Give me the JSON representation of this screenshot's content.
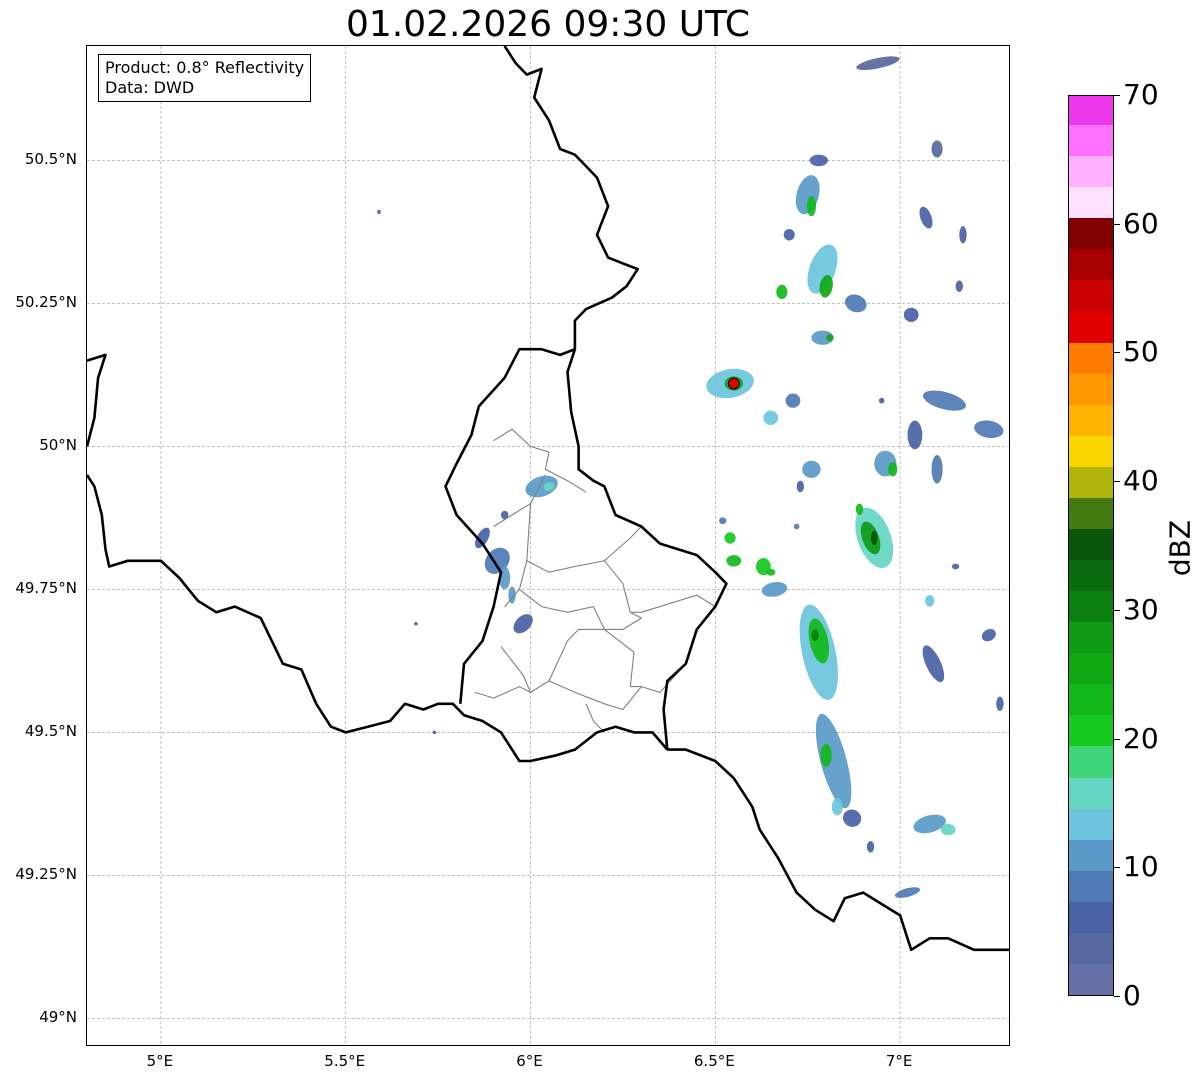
{
  "title": "01.02.2026 09:30 UTC",
  "info": {
    "product": "Product: 0.8° Reflectivity",
    "data": "Data: DWD"
  },
  "map_extent": {
    "lon": [
      4.8,
      7.3
    ],
    "lat": [
      48.95,
      50.7
    ]
  },
  "lat_ticks": [
    {
      "value": 50.5,
      "label": "50.5°N"
    },
    {
      "value": 50.25,
      "label": "50.25°N"
    },
    {
      "value": 50.0,
      "label": "50°N"
    },
    {
      "value": 49.75,
      "label": "49.75°N"
    },
    {
      "value": 49.5,
      "label": "49.5°N"
    },
    {
      "value": 49.25,
      "label": "49.25°N"
    },
    {
      "value": 49.0,
      "label": "49°N"
    }
  ],
  "lon_ticks": [
    {
      "value": 5.0,
      "label": "5°E"
    },
    {
      "value": 5.5,
      "label": "5.5°E"
    },
    {
      "value": 6.0,
      "label": "6°E"
    },
    {
      "value": 6.5,
      "label": "6.5°E"
    },
    {
      "value": 7.0,
      "label": "7°E"
    }
  ],
  "radar_site": {
    "lon": 6.55,
    "lat": 50.11,
    "color": "#e00000"
  },
  "borders": {
    "country": [
      [
        [
          5.93,
          50.7
        ],
        [
          5.96,
          50.67
        ],
        [
          5.99,
          50.65
        ],
        [
          6.03,
          50.66
        ],
        [
          6.01,
          50.61
        ],
        [
          6.05,
          50.57
        ],
        [
          6.08,
          50.52
        ],
        [
          6.12,
          50.51
        ],
        [
          6.15,
          50.49
        ],
        [
          6.18,
          50.47
        ],
        [
          6.21,
          50.42
        ],
        [
          6.18,
          50.37
        ],
        [
          6.21,
          50.33
        ],
        [
          6.25,
          50.32
        ],
        [
          6.29,
          50.31
        ],
        [
          6.26,
          50.28
        ],
        [
          6.22,
          50.26
        ],
        [
          6.15,
          50.24
        ],
        [
          6.12,
          50.22
        ],
        [
          6.12,
          50.17
        ],
        [
          6.1,
          50.13
        ],
        [
          6.11,
          50.06
        ],
        [
          6.13,
          50.0
        ],
        [
          6.13,
          49.96
        ],
        [
          6.17,
          49.94
        ],
        [
          6.2,
          49.93
        ],
        [
          6.23,
          49.88
        ],
        [
          6.3,
          49.86
        ],
        [
          6.35,
          49.83
        ],
        [
          6.4,
          49.82
        ],
        [
          6.45,
          49.81
        ],
        [
          6.5,
          49.78
        ],
        [
          6.53,
          49.76
        ],
        [
          6.5,
          49.72
        ],
        [
          6.45,
          49.68
        ],
        [
          6.42,
          49.62
        ],
        [
          6.37,
          49.59
        ],
        [
          6.36,
          49.54
        ],
        [
          6.37,
          49.47
        ]
      ],
      [
        [
          6.37,
          49.47
        ],
        [
          6.33,
          49.5
        ],
        [
          6.28,
          49.5
        ],
        [
          6.23,
          49.51
        ],
        [
          6.18,
          49.5
        ],
        [
          6.12,
          49.47
        ],
        [
          6.07,
          49.46
        ],
        [
          6.0,
          49.45
        ],
        [
          5.97,
          49.45
        ],
        [
          5.92,
          49.5
        ],
        [
          5.87,
          49.52
        ],
        [
          5.82,
          49.53
        ],
        [
          5.79,
          49.55
        ],
        [
          5.75,
          49.55
        ],
        [
          5.71,
          49.54
        ],
        [
          5.66,
          49.55
        ],
        [
          5.62,
          49.52
        ],
        [
          5.56,
          49.51
        ],
        [
          5.5,
          49.5
        ],
        [
          5.46,
          49.51
        ],
        [
          5.42,
          49.55
        ],
        [
          5.38,
          49.61
        ],
        [
          5.33,
          49.62
        ],
        [
          5.3,
          49.66
        ],
        [
          5.27,
          49.7
        ],
        [
          5.2,
          49.72
        ],
        [
          5.15,
          49.71
        ],
        [
          5.1,
          49.73
        ],
        [
          5.05,
          49.77
        ],
        [
          5.0,
          49.8
        ],
        [
          4.95,
          49.8
        ],
        [
          4.91,
          49.8
        ],
        [
          4.86,
          49.79
        ],
        [
          4.85,
          49.82
        ],
        [
          4.84,
          49.88
        ],
        [
          4.82,
          49.93
        ],
        [
          4.8,
          49.95
        ]
      ],
      [
        [
          6.37,
          49.47
        ],
        [
          6.42,
          49.47
        ],
        [
          6.5,
          49.45
        ],
        [
          6.55,
          49.42
        ],
        [
          6.6,
          49.37
        ],
        [
          6.62,
          49.33
        ],
        [
          6.67,
          49.28
        ],
        [
          6.72,
          49.22
        ],
        [
          6.77,
          49.19
        ],
        [
          6.82,
          49.17
        ],
        [
          6.85,
          49.21
        ],
        [
          6.9,
          49.22
        ],
        [
          6.95,
          49.2
        ],
        [
          7.0,
          49.18
        ],
        [
          7.03,
          49.12
        ],
        [
          7.08,
          49.14
        ],
        [
          7.13,
          49.14
        ],
        [
          7.2,
          49.12
        ],
        [
          7.25,
          49.12
        ],
        [
          7.3,
          49.12
        ]
      ],
      [
        [
          4.8,
          50.15
        ],
        [
          4.85,
          50.16
        ],
        [
          4.83,
          50.12
        ],
        [
          4.82,
          50.05
        ],
        [
          4.8,
          50.0
        ]
      ],
      [
        [
          5.81,
          49.55
        ],
        [
          5.82,
          49.62
        ],
        [
          5.87,
          49.66
        ],
        [
          5.9,
          49.72
        ],
        [
          5.92,
          49.78
        ],
        [
          5.87,
          49.83
        ],
        [
          5.8,
          49.88
        ],
        [
          5.77,
          49.93
        ],
        [
          5.8,
          49.97
        ],
        [
          5.84,
          50.02
        ],
        [
          5.86,
          50.07
        ],
        [
          5.93,
          50.12
        ],
        [
          5.97,
          50.17
        ],
        [
          6.03,
          50.17
        ],
        [
          6.08,
          50.16
        ],
        [
          6.12,
          50.17
        ]
      ]
    ],
    "admin": [
      [
        [
          5.9,
          50.01
        ],
        [
          5.95,
          50.03
        ],
        [
          6.0,
          50.0
        ],
        [
          6.05,
          49.99
        ],
        [
          6.04,
          49.96
        ],
        [
          6.1,
          49.94
        ],
        [
          6.15,
          49.92
        ]
      ],
      [
        [
          5.9,
          49.86
        ],
        [
          5.95,
          49.88
        ],
        [
          6.0,
          49.9
        ],
        [
          6.04,
          49.95
        ]
      ],
      [
        [
          6.0,
          49.9
        ],
        [
          5.99,
          49.8
        ],
        [
          6.05,
          49.78
        ],
        [
          6.12,
          49.79
        ],
        [
          6.2,
          49.8
        ],
        [
          6.27,
          49.84
        ],
        [
          6.3,
          49.86
        ]
      ],
      [
        [
          5.93,
          49.72
        ],
        [
          5.97,
          49.75
        ],
        [
          5.99,
          49.8
        ]
      ],
      [
        [
          6.2,
          49.8
        ],
        [
          6.25,
          49.76
        ],
        [
          6.27,
          49.71
        ],
        [
          6.3,
          49.71
        ],
        [
          6.4,
          49.73
        ],
        [
          6.45,
          49.74
        ],
        [
          6.5,
          49.72
        ]
      ],
      [
        [
          5.97,
          49.75
        ],
        [
          6.03,
          49.72
        ],
        [
          6.1,
          49.71
        ],
        [
          6.17,
          49.72
        ],
        [
          6.2,
          49.68
        ]
      ],
      [
        [
          6.2,
          49.68
        ],
        [
          6.25,
          49.68
        ],
        [
          6.3,
          49.7
        ],
        [
          6.27,
          49.71
        ]
      ],
      [
        [
          5.92,
          49.65
        ],
        [
          5.98,
          49.6
        ],
        [
          6.0,
          49.57
        ],
        [
          6.05,
          49.59
        ],
        [
          6.12,
          49.57
        ],
        [
          6.2,
          49.55
        ],
        [
          6.25,
          49.54
        ],
        [
          6.3,
          49.58
        ],
        [
          6.35,
          49.57
        ],
        [
          6.42,
          49.62
        ]
      ],
      [
        [
          6.2,
          49.68
        ],
        [
          6.28,
          49.64
        ],
        [
          6.27,
          49.58
        ],
        [
          6.3,
          49.58
        ]
      ],
      [
        [
          6.05,
          49.59
        ],
        [
          6.1,
          49.66
        ],
        [
          6.13,
          49.68
        ],
        [
          6.2,
          49.68
        ]
      ],
      [
        [
          5.85,
          49.57
        ],
        [
          5.9,
          49.56
        ],
        [
          5.97,
          49.58
        ],
        [
          6.0,
          49.57
        ]
      ],
      [
        [
          6.15,
          49.55
        ],
        [
          6.17,
          49.52
        ],
        [
          6.2,
          49.5
        ]
      ]
    ]
  },
  "echoes": [
    {
      "lon": 6.94,
      "lat": 50.67,
      "w": 0.12,
      "h": 0.018,
      "rot": -12,
      "dbz": 3
    },
    {
      "lon": 6.78,
      "lat": 50.5,
      "w": 0.05,
      "h": 0.02,
      "rot": 0,
      "dbz": 5
    },
    {
      "lon": 6.75,
      "lat": 50.44,
      "w": 0.06,
      "h": 0.07,
      "rot": 15,
      "dbz": 12
    },
    {
      "lon": 6.76,
      "lat": 50.42,
      "w": 0.025,
      "h": 0.035,
      "rot": 0,
      "dbz": 22
    },
    {
      "lon": 6.7,
      "lat": 50.37,
      "w": 0.03,
      "h": 0.02,
      "rot": 0,
      "dbz": 6
    },
    {
      "lon": 6.79,
      "lat": 50.31,
      "w": 0.07,
      "h": 0.09,
      "rot": 20,
      "dbz": 14
    },
    {
      "lon": 6.8,
      "lat": 50.28,
      "w": 0.035,
      "h": 0.04,
      "rot": 10,
      "dbz": 26
    },
    {
      "lon": 6.68,
      "lat": 50.27,
      "w": 0.03,
      "h": 0.025,
      "rot": 0,
      "dbz": 22
    },
    {
      "lon": 6.88,
      "lat": 50.25,
      "w": 0.06,
      "h": 0.03,
      "rot": 20,
      "dbz": 8
    },
    {
      "lon": 6.79,
      "lat": 50.19,
      "w": 0.06,
      "h": 0.025,
      "rot": 0,
      "dbz": 12
    },
    {
      "lon": 6.81,
      "lat": 50.19,
      "w": 0.02,
      "h": 0.012,
      "rot": 0,
      "dbz": 26
    },
    {
      "lon": 7.03,
      "lat": 50.23,
      "w": 0.04,
      "h": 0.025,
      "rot": 0,
      "dbz": 6
    },
    {
      "lon": 7.07,
      "lat": 50.4,
      "w": 0.03,
      "h": 0.04,
      "rot": -20,
      "dbz": 6
    },
    {
      "lon": 7.17,
      "lat": 50.37,
      "w": 0.02,
      "h": 0.03,
      "rot": 0,
      "dbz": 6
    },
    {
      "lon": 7.16,
      "lat": 50.28,
      "w": 0.02,
      "h": 0.02,
      "rot": 0,
      "dbz": 6
    },
    {
      "lon": 7.1,
      "lat": 50.52,
      "w": 0.03,
      "h": 0.03,
      "rot": 0,
      "dbz": 3
    },
    {
      "lon": 5.59,
      "lat": 50.41,
      "w": 0.01,
      "h": 0.008,
      "rot": 0,
      "dbz": 5
    },
    {
      "lon": 6.54,
      "lat": 50.11,
      "w": 0.13,
      "h": 0.05,
      "rot": -10,
      "dbz": 14
    },
    {
      "lon": 6.55,
      "lat": 50.11,
      "w": 0.05,
      "h": 0.025,
      "rot": 0,
      "dbz": 25
    },
    {
      "lon": 6.65,
      "lat": 50.05,
      "w": 0.04,
      "h": 0.025,
      "rot": 0,
      "dbz": 14
    },
    {
      "lon": 6.71,
      "lat": 50.08,
      "w": 0.04,
      "h": 0.025,
      "rot": 0,
      "dbz": 8
    },
    {
      "lon": 7.12,
      "lat": 50.08,
      "w": 0.12,
      "h": 0.03,
      "rot": 15,
      "dbz": 8
    },
    {
      "lon": 7.24,
      "lat": 50.03,
      "w": 0.08,
      "h": 0.03,
      "rot": 10,
      "dbz": 8
    },
    {
      "lon": 7.04,
      "lat": 50.02,
      "w": 0.04,
      "h": 0.05,
      "rot": 0,
      "dbz": 6
    },
    {
      "lon": 6.96,
      "lat": 49.97,
      "w": 0.06,
      "h": 0.045,
      "rot": 0,
      "dbz": 10
    },
    {
      "lon": 6.98,
      "lat": 49.96,
      "w": 0.025,
      "h": 0.025,
      "rot": 0,
      "dbz": 22
    },
    {
      "lon": 7.1,
      "lat": 49.96,
      "w": 0.03,
      "h": 0.05,
      "rot": 0,
      "dbz": 8
    },
    {
      "lon": 6.76,
      "lat": 49.96,
      "w": 0.05,
      "h": 0.03,
      "rot": 0,
      "dbz": 12
    },
    {
      "lon": 6.73,
      "lat": 49.93,
      "w": 0.02,
      "h": 0.02,
      "rot": 0,
      "dbz": 6
    },
    {
      "lon": 6.93,
      "lat": 49.84,
      "w": 0.09,
      "h": 0.11,
      "rot": -20,
      "dbz": 16
    },
    {
      "lon": 6.92,
      "lat": 49.84,
      "w": 0.045,
      "h": 0.06,
      "rot": -20,
      "dbz": 28
    },
    {
      "lon": 6.93,
      "lat": 49.84,
      "w": 0.018,
      "h": 0.025,
      "rot": 0,
      "dbz": 34
    },
    {
      "lon": 6.89,
      "lat": 49.89,
      "w": 0.02,
      "h": 0.02,
      "rot": 0,
      "dbz": 22
    },
    {
      "lon": 7.08,
      "lat": 49.73,
      "w": 0.025,
      "h": 0.02,
      "rot": 0,
      "dbz": 14
    },
    {
      "lon": 7.15,
      "lat": 49.79,
      "w": 0.02,
      "h": 0.01,
      "rot": 0,
      "dbz": 6
    },
    {
      "lon": 6.03,
      "lat": 49.93,
      "w": 0.09,
      "h": 0.035,
      "rot": -18,
      "dbz": 10
    },
    {
      "lon": 6.05,
      "lat": 49.93,
      "w": 0.03,
      "h": 0.015,
      "rot": -18,
      "dbz": 16
    },
    {
      "lon": 5.91,
      "lat": 49.8,
      "w": 0.06,
      "h": 0.05,
      "rot": 40,
      "dbz": 8
    },
    {
      "lon": 5.93,
      "lat": 49.77,
      "w": 0.03,
      "h": 0.04,
      "rot": 0,
      "dbz": 12
    },
    {
      "lon": 5.87,
      "lat": 49.84,
      "w": 0.03,
      "h": 0.04,
      "rot": 30,
      "dbz": 7
    },
    {
      "lon": 5.95,
      "lat": 49.74,
      "w": 0.02,
      "h": 0.03,
      "rot": 0,
      "dbz": 10
    },
    {
      "lon": 5.93,
      "lat": 49.88,
      "w": 0.02,
      "h": 0.015,
      "rot": 0,
      "dbz": 6
    },
    {
      "lon": 5.98,
      "lat": 49.69,
      "w": 0.04,
      "h": 0.04,
      "rot": 45,
      "dbz": 6
    },
    {
      "lon": 6.54,
      "lat": 49.84,
      "w": 0.03,
      "h": 0.02,
      "rot": 0,
      "dbz": 20
    },
    {
      "lon": 6.55,
      "lat": 49.8,
      "w": 0.04,
      "h": 0.02,
      "rot": 0,
      "dbz": 22
    },
    {
      "lon": 6.63,
      "lat": 49.79,
      "w": 0.04,
      "h": 0.03,
      "rot": 0,
      "dbz": 20
    },
    {
      "lon": 6.66,
      "lat": 49.75,
      "w": 0.07,
      "h": 0.025,
      "rot": -10,
      "dbz": 12
    },
    {
      "lon": 6.65,
      "lat": 49.78,
      "w": 0.025,
      "h": 0.012,
      "rot": 0,
      "dbz": 24
    },
    {
      "lon": 6.52,
      "lat": 49.87,
      "w": 0.02,
      "h": 0.012,
      "rot": 0,
      "dbz": 8
    },
    {
      "lon": 6.72,
      "lat": 49.86,
      "w": 0.015,
      "h": 0.01,
      "rot": 0,
      "dbz": 8
    },
    {
      "lon": 6.78,
      "lat": 49.64,
      "w": 0.09,
      "h": 0.17,
      "rot": -12,
      "dbz": 14
    },
    {
      "lon": 6.78,
      "lat": 49.66,
      "w": 0.05,
      "h": 0.08,
      "rot": -12,
      "dbz": 24
    },
    {
      "lon": 6.77,
      "lat": 49.67,
      "w": 0.02,
      "h": 0.02,
      "rot": 0,
      "dbz": 30
    },
    {
      "lon": 6.82,
      "lat": 49.45,
      "w": 0.07,
      "h": 0.17,
      "rot": -15,
      "dbz": 12
    },
    {
      "lon": 6.8,
      "lat": 49.46,
      "w": 0.03,
      "h": 0.04,
      "rot": 0,
      "dbz": 22
    },
    {
      "lon": 6.83,
      "lat": 49.37,
      "w": 0.03,
      "h": 0.03,
      "rot": 0,
      "dbz": 14
    },
    {
      "lon": 6.87,
      "lat": 49.35,
      "w": 0.05,
      "h": 0.03,
      "rot": 20,
      "dbz": 6
    },
    {
      "lon": 6.92,
      "lat": 49.3,
      "w": 0.02,
      "h": 0.02,
      "rot": 0,
      "dbz": 6
    },
    {
      "lon": 7.08,
      "lat": 49.34,
      "w": 0.09,
      "h": 0.03,
      "rot": -15,
      "dbz": 10
    },
    {
      "lon": 7.13,
      "lat": 49.33,
      "w": 0.04,
      "h": 0.02,
      "rot": 0,
      "dbz": 16
    },
    {
      "lon": 7.09,
      "lat": 49.62,
      "w": 0.04,
      "h": 0.07,
      "rot": -25,
      "dbz": 7
    },
    {
      "lon": 7.24,
      "lat": 49.67,
      "w": 0.04,
      "h": 0.02,
      "rot": -30,
      "dbz": 6
    },
    {
      "lon": 7.27,
      "lat": 49.55,
      "w": 0.02,
      "h": 0.025,
      "rot": 0,
      "dbz": 6
    },
    {
      "lon": 7.02,
      "lat": 49.22,
      "w": 0.07,
      "h": 0.015,
      "rot": -15,
      "dbz": 8
    },
    {
      "lon": 5.74,
      "lat": 49.5,
      "w": 0.01,
      "h": 0.006,
      "rot": 0,
      "dbz": 5
    },
    {
      "lon": 5.69,
      "lat": 49.69,
      "w": 0.01,
      "h": 0.006,
      "rot": 0,
      "dbz": 5
    },
    {
      "lon": 6.95,
      "lat": 50.08,
      "w": 0.015,
      "h": 0.01,
      "rot": 0,
      "dbz": 5
    }
  ],
  "colorbar": {
    "label": "dBZ",
    "range": [
      0,
      70
    ],
    "ticks": [
      0,
      10,
      20,
      30,
      40,
      50,
      60,
      70
    ],
    "colors": [
      "#6670a8",
      "#5868a0",
      "#4a62a5",
      "#4f7ab5",
      "#5a9ac8",
      "#6bc4dc",
      "#64d6c2",
      "#3ed67a",
      "#14c81e",
      "#12b81a",
      "#10a814",
      "#0e9a14",
      "#0b7f10",
      "#0a6c0e",
      "#0a560c",
      "#457a10",
      "#b1b309",
      "#f9d600",
      "#ffb300",
      "#ff9800",
      "#ff7c00",
      "#e00000",
      "#c80000",
      "#a80000",
      "#820000",
      "#ffe0ff",
      "#ffb0ff",
      "#ff70ff",
      "#ee38ee"
    ]
  }
}
